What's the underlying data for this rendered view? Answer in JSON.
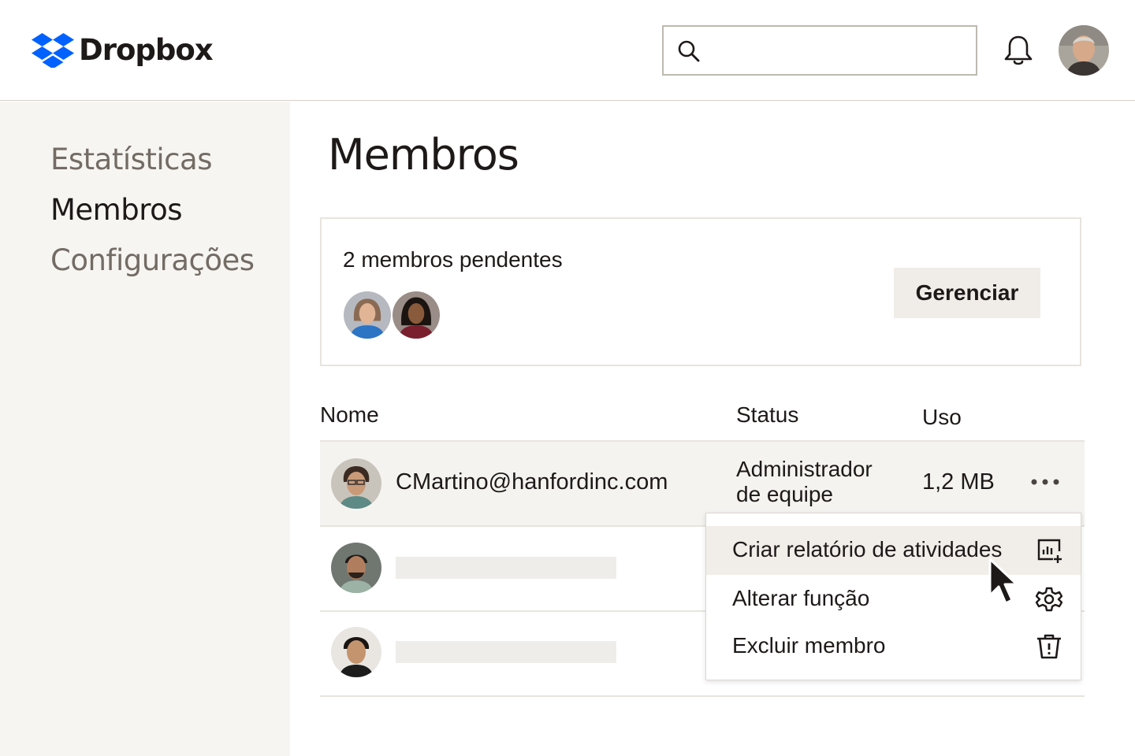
{
  "header": {
    "brand": "Dropbox",
    "brand_color": "#0061fe",
    "search": {
      "value": "",
      "placeholder": "",
      "icon": "search-icon"
    },
    "notifications_icon": "bell-icon",
    "user_avatar": "avatar"
  },
  "sidebar": {
    "items": [
      {
        "label": "Estatísticas",
        "active": false
      },
      {
        "label": "Membros",
        "active": true
      },
      {
        "label": "Configurações",
        "active": false
      }
    ]
  },
  "main": {
    "title": "Membros",
    "pending": {
      "text": "2 membros pendentes",
      "manage_label": "Gerenciar"
    },
    "table": {
      "columns": [
        "Nome",
        "Status",
        "Uso"
      ],
      "rows": [
        {
          "email": "CMartino@hanfordinc.com",
          "status_line1": "Administrador",
          "status_line2": "de equipe",
          "usage": "1,2 MB",
          "selected": true
        },
        {
          "email": "",
          "status_line1": "",
          "status_line2": "",
          "usage": ""
        },
        {
          "email": "",
          "status_line1": "",
          "status_line2": "",
          "usage": ""
        }
      ]
    },
    "row_menu": {
      "items": [
        {
          "label": "Criar relatório de atividades",
          "icon": "report-add-icon",
          "hover": true
        },
        {
          "label": "Alterar função",
          "icon": "gear-icon"
        },
        {
          "label": "Excluir membro",
          "icon": "trash-icon"
        }
      ]
    }
  }
}
